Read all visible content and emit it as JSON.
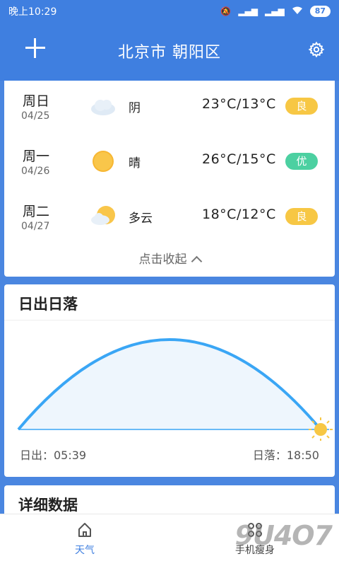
{
  "status_bar": {
    "time": "晚上10:29",
    "battery": "87"
  },
  "header": {
    "city": "北京市  朝阳区"
  },
  "forecast": {
    "days": [
      {
        "day": "周日",
        "date": "04/25",
        "weather": "阴",
        "icon": "cloudy-icon",
        "temp": "23°C/13°C",
        "aqi": "良",
        "aqi_color": "#f7c744"
      },
      {
        "day": "周一",
        "date": "04/26",
        "weather": "晴",
        "icon": "sunny-icon",
        "temp": "26°C/15°C",
        "aqi": "优",
        "aqi_color": "#4cd0a1"
      },
      {
        "day": "周二",
        "date": "04/27",
        "weather": "多云",
        "icon": "partly-cloudy-icon",
        "temp": "18°C/12°C",
        "aqi": "良",
        "aqi_color": "#f7c744"
      }
    ],
    "collapse_label": "点击收起"
  },
  "sun": {
    "title": "日出日落",
    "sunrise": "日出：05:39",
    "sunset": "日落：18:50",
    "progress": 1.0
  },
  "detail": {
    "title": "详细数据"
  },
  "nav": {
    "weather_label": "天气",
    "tools_label": "手机瘦身",
    "watermark": "9U4O7"
  },
  "colors": {
    "primary": "#3f7fe0",
    "arc": "#3aa6f5",
    "sun": "#f7c744"
  }
}
